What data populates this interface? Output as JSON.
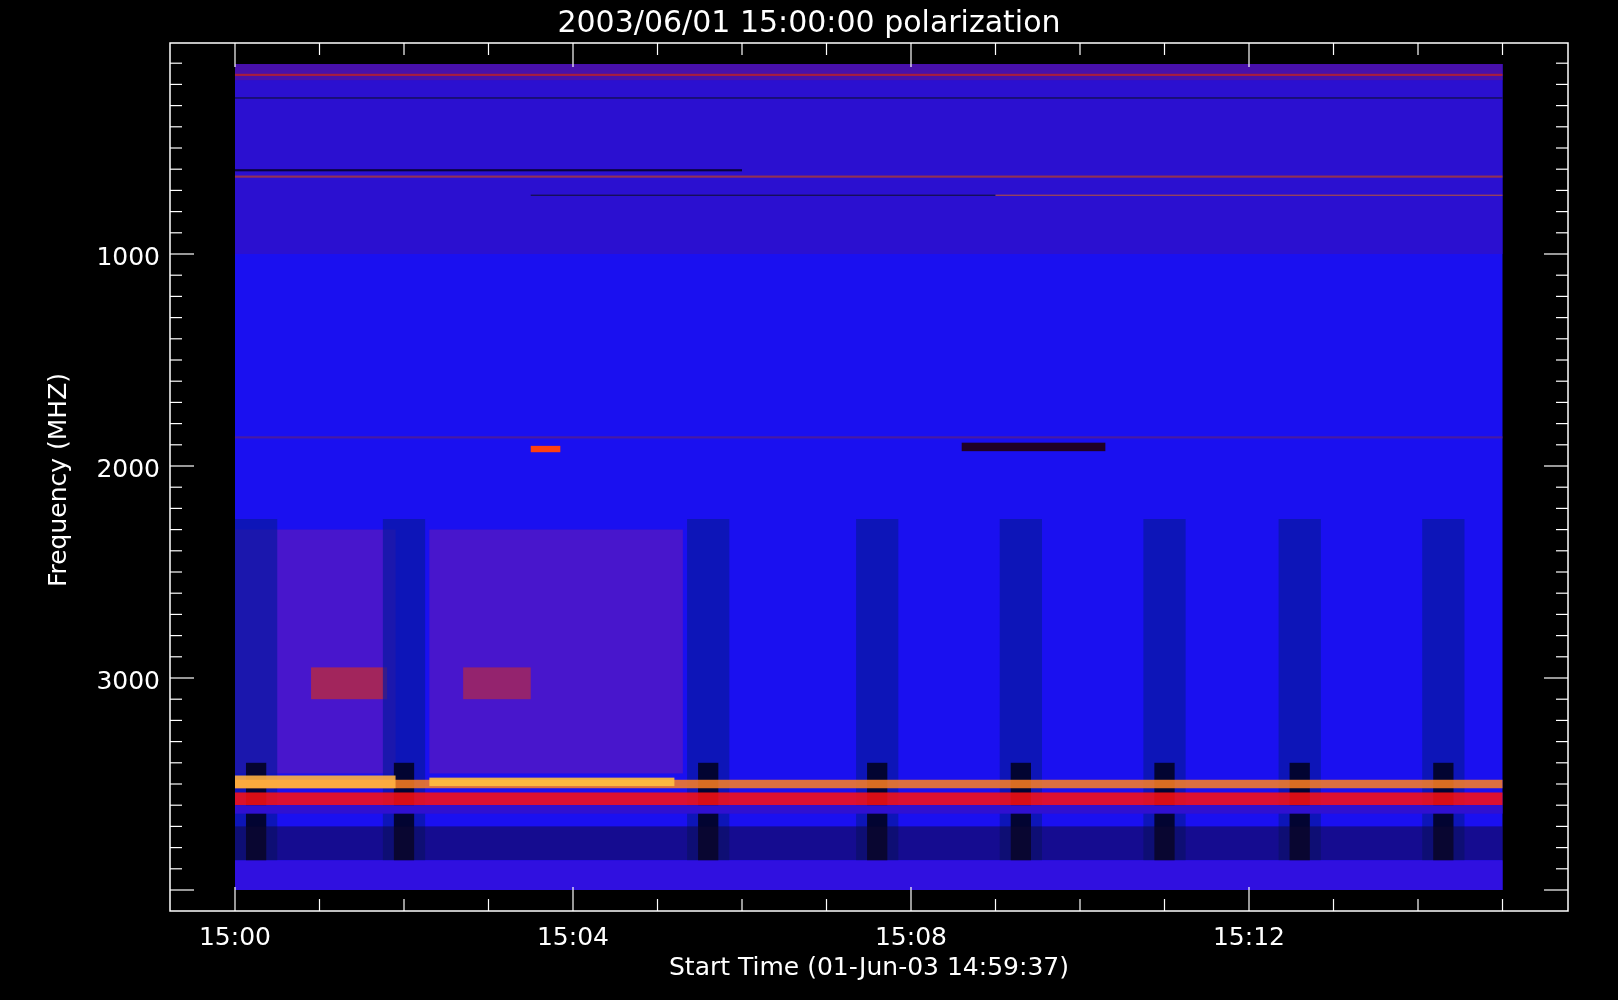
{
  "plot": {
    "title": "2003/06/01 15:00:00 polarization",
    "ylabel": "Frequency (MHZ)",
    "xlabel": "Start Time (01-Jun-03 14:59:37)",
    "y_tick_labels": [
      "1000",
      "2000",
      "3000"
    ],
    "x_tick_labels": [
      "15:00",
      "15:04",
      "15:08",
      "15:12"
    ]
  }
}
